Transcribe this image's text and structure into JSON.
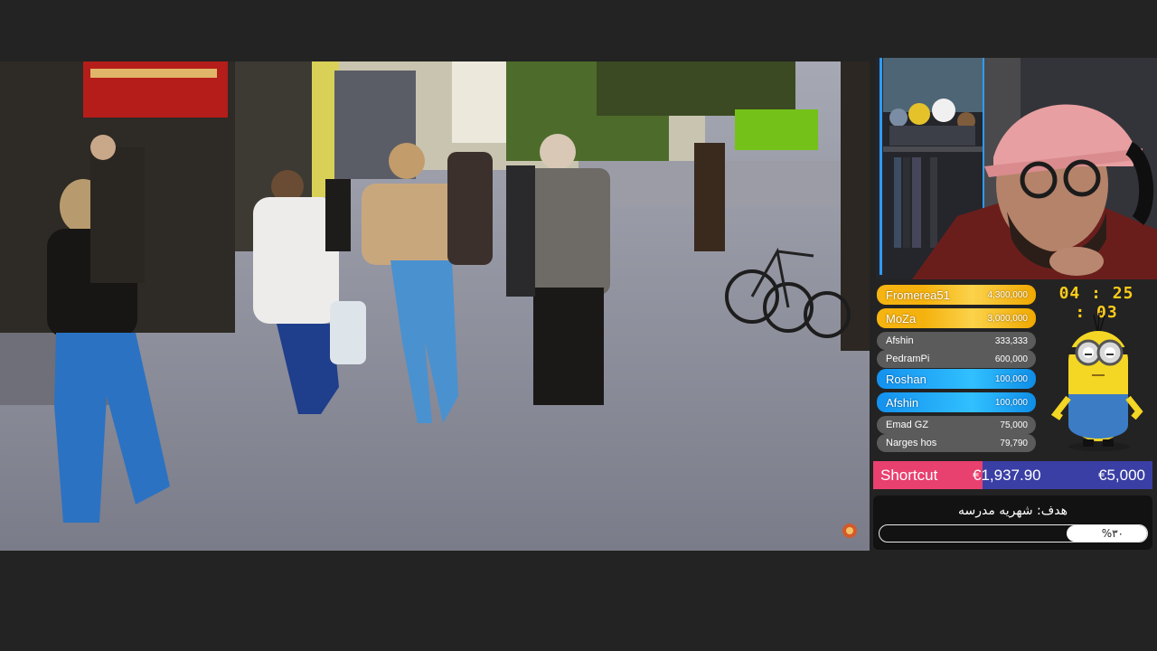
{
  "donations": [
    {
      "name": "Fromerea51",
      "amount": "4,300,000",
      "tier": "gold"
    },
    {
      "name": "MoZa",
      "amount": "3,000,000",
      "tier": "gold"
    },
    {
      "name": "Afshin",
      "amount": "333,333",
      "tier": "grey"
    },
    {
      "name": "PedramPi",
      "amount": "600,000",
      "tier": "grey"
    },
    {
      "name": "Roshan",
      "amount": "100,000",
      "tier": "blue"
    },
    {
      "name": "Afshin",
      "amount": "100,000",
      "tier": "blue"
    },
    {
      "name": "Emad GZ",
      "amount": "75,000",
      "tier": "grey"
    },
    {
      "name": "Narges hos",
      "amount": "79,790",
      "tier": "grey"
    }
  ],
  "timer": "04 : 25 : 03",
  "goal_bar": {
    "label": "Shortcut",
    "current": "€1,937.90",
    "target": "€5,000",
    "progress": 0.39
  },
  "goal": {
    "title": "هدف: شهریه مدرسه",
    "percent_label": "%۳۰",
    "progress": 0.3
  },
  "colors": {
    "gold": "#f5b20e",
    "blue": "#1fa6f5",
    "pink": "#e8406f",
    "indigo": "#3a3fa5",
    "timer": "#ffcc1a"
  }
}
